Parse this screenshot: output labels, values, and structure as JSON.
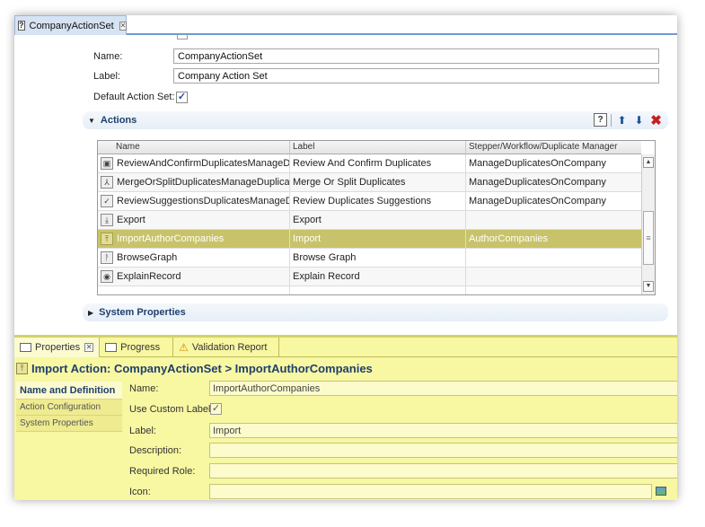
{
  "editor": {
    "tab_title": "CompanyActionSet",
    "tab_icon": "question-mark-icon",
    "form": {
      "name_label": "Name:",
      "name_value": "CompanyActionSet",
      "label_label": "Label:",
      "label_value": "Company Action Set",
      "default_label": "Default Action Set:",
      "default_checked": true
    },
    "actions": {
      "title": "Actions",
      "columns": [
        "Name",
        "Label",
        "Stepper/Workflow/Duplicate Manager"
      ],
      "rows": [
        {
          "icon": "person-card-icon",
          "name": "ReviewAndConfirmDuplicatesManageDup...",
          "label": "Review And Confirm Duplicates",
          "manager": "ManageDuplicatesOnCompany"
        },
        {
          "icon": "merge-split-icon",
          "name": "MergeOrSplitDuplicatesManageDuplicates...",
          "label": "Merge Or Split Duplicates",
          "manager": "ManageDuplicatesOnCompany"
        },
        {
          "icon": "review-check-icon",
          "name": "ReviewSuggestionsDuplicatesManageDup...",
          "label": "Review Duplicates Suggestions",
          "manager": "ManageDuplicatesOnCompany"
        },
        {
          "icon": "export-icon",
          "name": "Export",
          "label": "Export",
          "manager": ""
        },
        {
          "icon": "import-icon",
          "name": "ImportAuthorCompanies",
          "label": "Import",
          "manager": "AuthorCompanies",
          "selected": true
        },
        {
          "icon": "graph-icon",
          "name": "BrowseGraph",
          "label": "Browse Graph",
          "manager": ""
        },
        {
          "icon": "eye-icon",
          "name": "ExplainRecord",
          "label": "Explain Record",
          "manager": ""
        }
      ]
    },
    "system_properties_title": "System Properties"
  },
  "properties": {
    "tabs": [
      "Properties",
      "Progress",
      "Validation Report"
    ],
    "title": "Import Action: CompanyActionSet > ImportAuthorCompanies",
    "nav": [
      "Name and Definition",
      "Action Configuration",
      "System Properties"
    ],
    "fields": {
      "name_label": "Name:",
      "name_value": "ImportAuthorCompanies",
      "custom_label": "Use Custom Label:",
      "custom_checked": true,
      "label_label": "Label:",
      "label_value": "Import",
      "description_label": "Description:",
      "description_value": "",
      "role_label": "Required Role:",
      "role_value": "",
      "icon_label": "Icon:",
      "icon_value": ""
    }
  },
  "colors": {
    "selected_row": "#c8c36a",
    "properties_bg": "#f8f7a2",
    "section_title": "#1f3f6e"
  }
}
